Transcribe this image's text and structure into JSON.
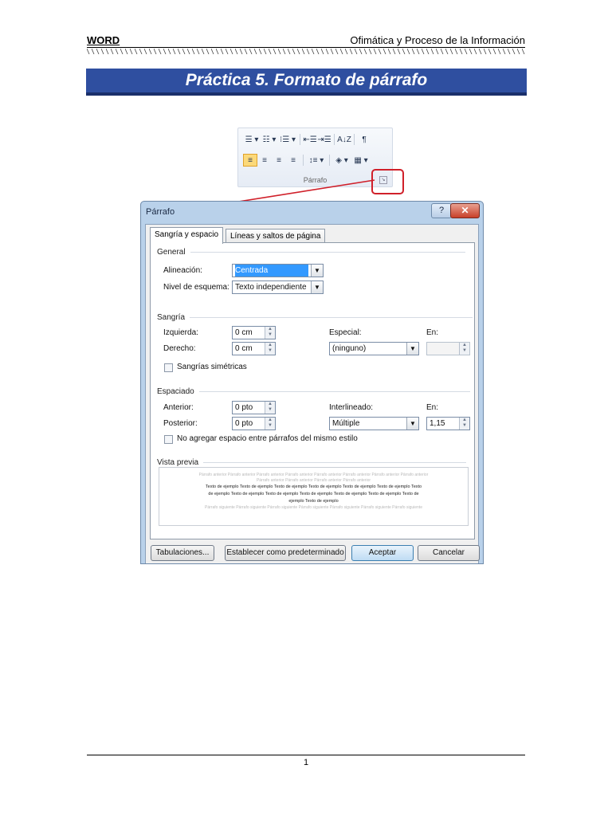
{
  "header": {
    "left": "WORD",
    "right": "Ofimática y Proceso de la Información"
  },
  "title": "Práctica 5. Formato de párrafo",
  "ribbon": {
    "row1": [
      "☰ ▾",
      "☷ ▾",
      "⁝☰ ▾",
      "⇤☰",
      "⇥☰",
      "A↓Z",
      "¶"
    ],
    "row2": [
      "≡",
      "≡",
      "≡",
      "≡",
      "↕≡ ▾",
      "◈ ▾",
      "▦ ▾"
    ],
    "group_label": "Párrafo",
    "launcher": "↘"
  },
  "dialog": {
    "title": "Párrafo",
    "help": "?",
    "close": "✕",
    "tabs": [
      "Sangría y espacio",
      "Líneas y saltos de página"
    ],
    "general": {
      "section": "General",
      "alineacion_label": "Alineación:",
      "alineacion_value": "Centrada",
      "nivel_label": "Nivel de esquema:",
      "nivel_value": "Texto independiente"
    },
    "sangria": {
      "section": "Sangría",
      "izquierda_label": "Izquierda:",
      "izquierda_value": "0 cm",
      "derecho_label": "Derecho:",
      "derecho_value": "0 cm",
      "especial_label": "Especial:",
      "especial_value": "(ninguno)",
      "en_label": "En:",
      "en_value": "",
      "simetricas_label": "Sangrías simétricas"
    },
    "espaciado": {
      "section": "Espaciado",
      "anterior_label": "Anterior:",
      "anterior_value": "0 pto",
      "posterior_label": "Posterior:",
      "posterior_value": "0 pto",
      "interlineado_label": "Interlineado:",
      "interlineado_value": "Múltiple",
      "en_label": "En:",
      "en_value": "1,15",
      "no_agregar_label": "No agregar espacio entre párrafos del mismo estilo"
    },
    "vista_previa": {
      "section": "Vista previa",
      "before1": "Párrafo anterior Párrafo anterior Párrafo anterior Párrafo anterior Párrafo anterior Párrafo anterior Párrafo anterior Párrafo anterior",
      "before2": "Párrafo anterior Párrafo anterior Párrafo anterior Párrafo anterior",
      "sample1": "Texto de ejemplo Texto de ejemplo Texto de ejemplo Texto de ejemplo Texto de ejemplo Texto de ejemplo Texto",
      "sample2": "de ejemplo Texto de ejemplo Texto de ejemplo Texto de ejemplo Texto de ejemplo Texto de ejemplo Texto de",
      "sample3": "ejemplo Texto de ejemplo",
      "after1": "Párrafo siguiente Párrafo siguiente Párrafo siguiente Párrafo siguiente Párrafo siguiente Párrafo siguiente Párrafo siguiente"
    },
    "buttons": {
      "tabulaciones": "Tabulaciones...",
      "predeterminado": "Establecer como predeterminado",
      "aceptar": "Aceptar",
      "cancelar": "Cancelar"
    }
  },
  "footer": {
    "page": "1"
  },
  "colors": {
    "title_bar": "#2f4fa0",
    "callout": "#d0202a"
  }
}
